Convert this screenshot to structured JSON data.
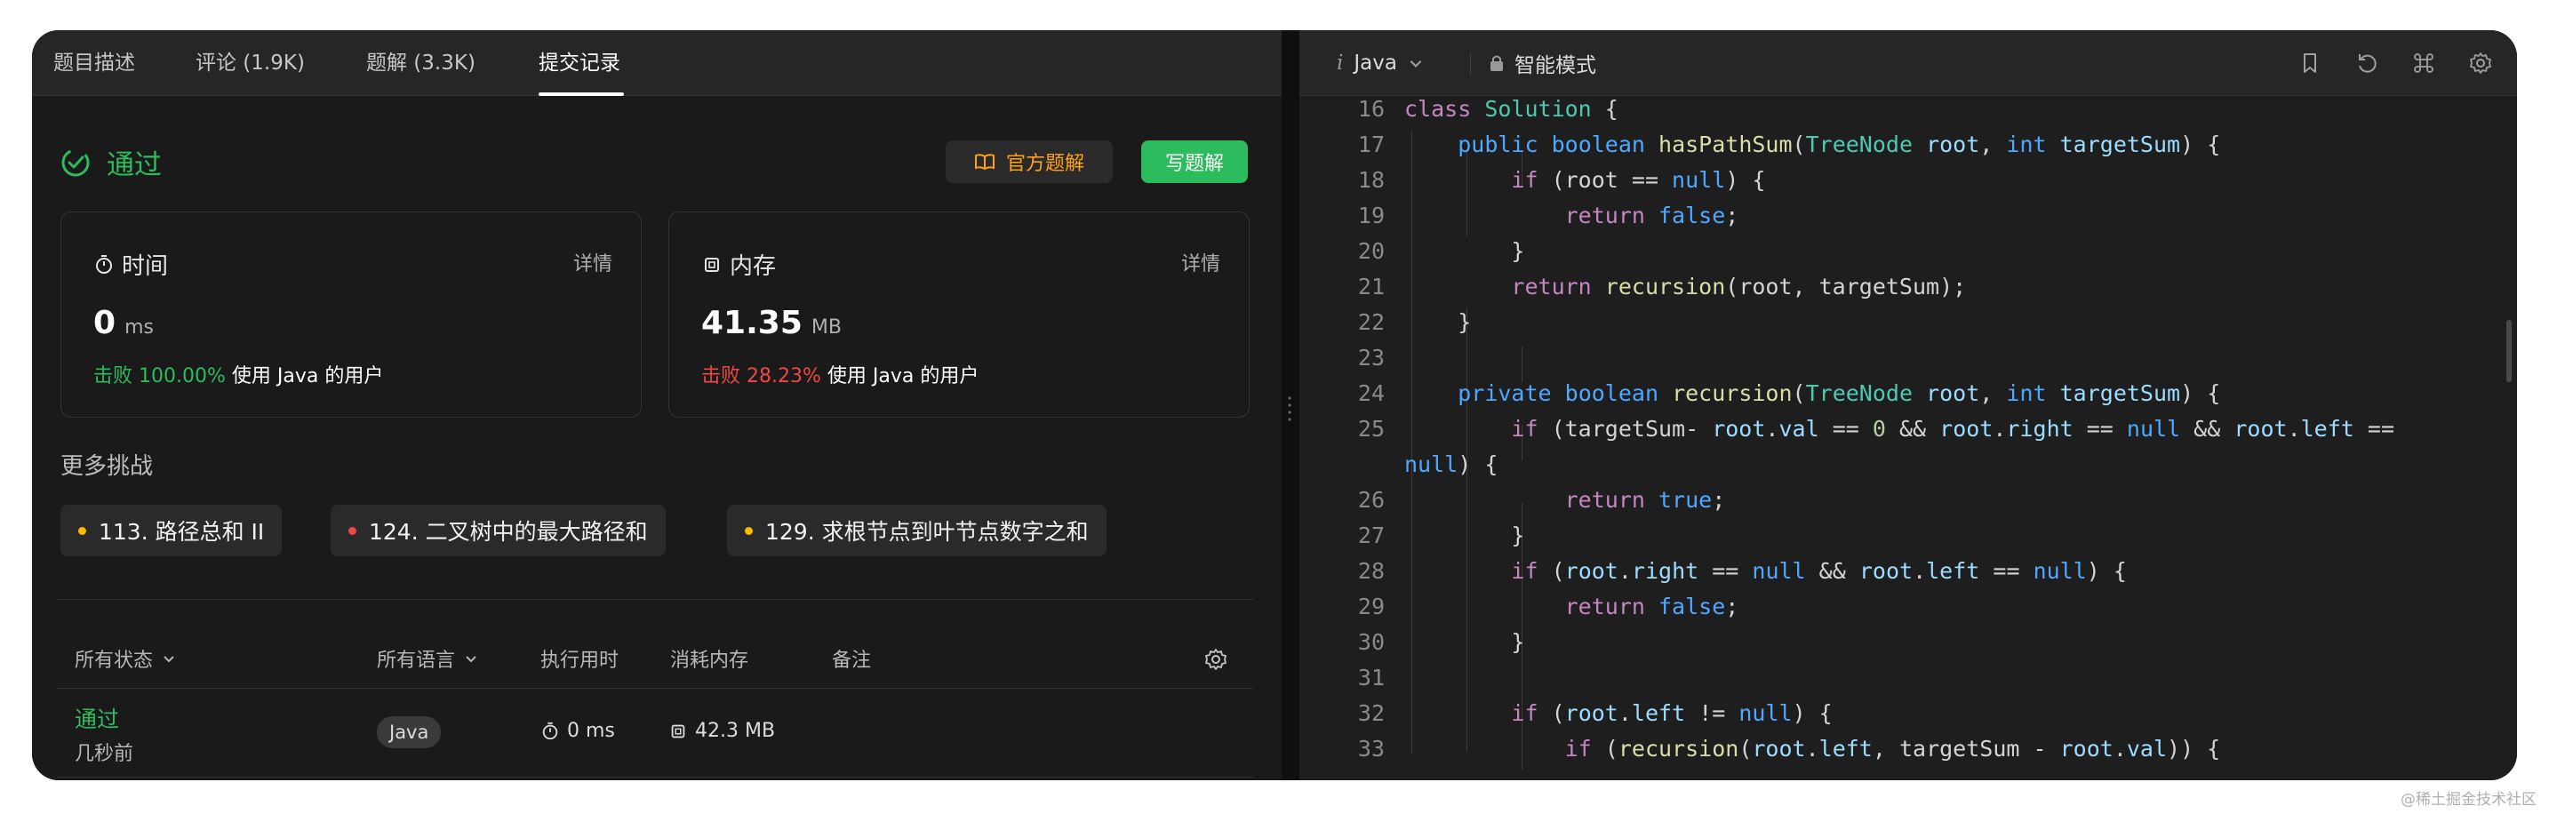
{
  "tabs": [
    {
      "label": "题目描述"
    },
    {
      "label": "评论 (1.9K)"
    },
    {
      "label": "题解 (3.3K)"
    },
    {
      "label": "提交记录"
    }
  ],
  "result": {
    "status": "通过",
    "official_button": "官方题解",
    "write_button": "写题解"
  },
  "time_card": {
    "title": "时间",
    "detail": "详情",
    "value": "0",
    "unit": "ms",
    "beat_label": "击败 100.00%",
    "beat_suffix": "使用 Java 的用户"
  },
  "mem_card": {
    "title": "内存",
    "detail": "详情",
    "value": "41.35",
    "unit": "MB",
    "beat_label": "击败 28.23%",
    "beat_suffix": "使用 Java 的用户"
  },
  "more": {
    "title": "更多挑战",
    "chips": [
      {
        "label": "113. 路径总和 II",
        "color": "#ffb800"
      },
      {
        "label": "124. 二叉树中的最大路径和",
        "color": "#ef4743"
      },
      {
        "label": "129. 求根节点到叶节点数字之和",
        "color": "#ffb800"
      }
    ]
  },
  "table": {
    "headers": {
      "status": "所有状态",
      "lang": "所有语言",
      "runtime": "执行用时",
      "memory": "消耗内存",
      "note": "备注"
    },
    "row": {
      "status": "通过",
      "time": "几秒前",
      "lang": "Java",
      "runtime": "0 ms",
      "memory": "42.3 MB"
    }
  },
  "editor": {
    "language": "Java",
    "mode": "智能模式",
    "lines": [
      "16",
      "17",
      "18",
      "19",
      "20",
      "21",
      "22",
      "23",
      "24",
      "25",
      "",
      "26",
      "27",
      "28",
      "29",
      "30",
      "31",
      "32",
      "33"
    ]
  },
  "icons": [
    "check-circle-icon",
    "book-icon",
    "stopwatch-icon",
    "chip-icon",
    "chevron-down-icon",
    "gear-icon",
    "lock-icon",
    "bookmark-icon",
    "reset-icon",
    "command-icon",
    "settings-icon",
    "expand-icon"
  ],
  "watermark": "@稀土掘金技术社区"
}
